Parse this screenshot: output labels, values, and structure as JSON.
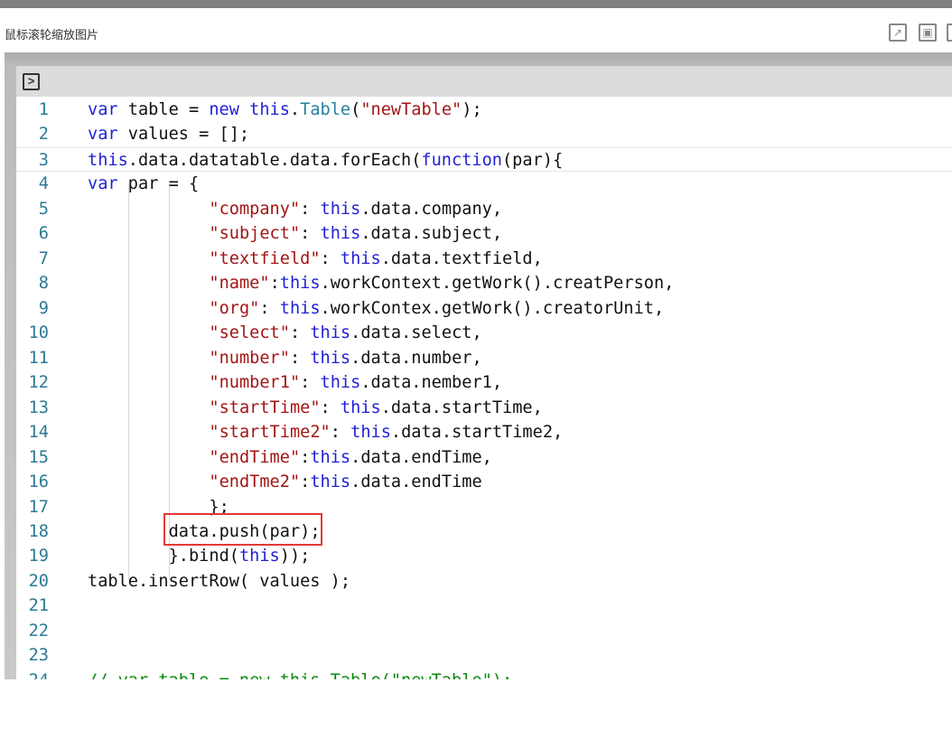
{
  "header": {
    "title": "鼠标滚轮缩放图片",
    "icons": [
      "open-external-icon",
      "fit-screen-icon",
      "more-icon"
    ]
  },
  "toolbar": {
    "run_icon": ">"
  },
  "colors": {
    "keyword": "#1f1fd8",
    "string": "#a31515",
    "highlight_box": "#e53935"
  },
  "code": {
    "highlighted_line": 18,
    "lines": [
      {
        "n": "1",
        "indent": 0,
        "t": [
          [
            "var",
            "kw"
          ],
          " table = ",
          [
            "new",
            "kw"
          ],
          " ",
          [
            "this",
            "kw"
          ],
          ".",
          [
            "Table",
            "cls"
          ],
          "(",
          [
            "\"newTable\"",
            "str"
          ],
          ");"
        ]
      },
      {
        "n": "2",
        "indent": 0,
        "t": [
          [
            "var",
            "kw"
          ],
          " values = [];"
        ]
      },
      {
        "n": "3",
        "indent": 0,
        "t": [
          [
            "this",
            "kw"
          ],
          ".data.datatable.data.forEach(",
          [
            "function",
            "kw"
          ],
          "(par){"
        ]
      },
      {
        "n": "4",
        "indent": 0,
        "t": [
          [
            "var",
            "kw"
          ],
          " par = {"
        ]
      },
      {
        "n": "5",
        "indent": 12,
        "t": [
          [
            "\"company\"",
            "str"
          ],
          ": ",
          [
            "this",
            "kw"
          ],
          ".data.company,"
        ]
      },
      {
        "n": "6",
        "indent": 12,
        "t": [
          [
            "\"subject\"",
            "str"
          ],
          ": ",
          [
            "this",
            "kw"
          ],
          ".data.subject,"
        ]
      },
      {
        "n": "7",
        "indent": 12,
        "t": [
          [
            "\"textfield\"",
            "str"
          ],
          ": ",
          [
            "this",
            "kw"
          ],
          ".data.textfield,"
        ]
      },
      {
        "n": "8",
        "indent": 12,
        "t": [
          [
            "\"name\"",
            "str"
          ],
          ":",
          [
            "this",
            "kw"
          ],
          ".workContext.getWork().creatPerson,"
        ]
      },
      {
        "n": "9",
        "indent": 12,
        "t": [
          [
            "\"org\"",
            "str"
          ],
          ": ",
          [
            "this",
            "kw"
          ],
          ".workContex.getWork().creatorUnit,"
        ]
      },
      {
        "n": "10",
        "indent": 12,
        "t": [
          [
            "\"select\"",
            "str"
          ],
          ": ",
          [
            "this",
            "kw"
          ],
          ".data.select,"
        ]
      },
      {
        "n": "11",
        "indent": 12,
        "t": [
          [
            "\"number\"",
            "str"
          ],
          ": ",
          [
            "this",
            "kw"
          ],
          ".data.number,"
        ]
      },
      {
        "n": "12",
        "indent": 12,
        "t": [
          [
            "\"number1\"",
            "str"
          ],
          ": ",
          [
            "this",
            "kw"
          ],
          ".data.nember1,"
        ]
      },
      {
        "n": "13",
        "indent": 12,
        "t": [
          [
            "\"startTime\"",
            "str"
          ],
          ": ",
          [
            "this",
            "kw"
          ],
          ".data.startTime,"
        ]
      },
      {
        "n": "14",
        "indent": 12,
        "t": [
          [
            "\"startTime2\"",
            "str"
          ],
          ": ",
          [
            "this",
            "kw"
          ],
          ".data.startTime2,"
        ]
      },
      {
        "n": "15",
        "indent": 12,
        "t": [
          [
            "\"endTime\"",
            "str"
          ],
          ":",
          [
            "this",
            "kw"
          ],
          ".data.endTime,"
        ]
      },
      {
        "n": "16",
        "indent": 12,
        "t": [
          [
            "\"endTme2\"",
            "str"
          ],
          ":",
          [
            "this",
            "kw"
          ],
          ".data.endTime"
        ]
      },
      {
        "n": "17",
        "indent": 12,
        "t": [
          "};"
        ]
      },
      {
        "n": "18",
        "indent": 8,
        "t": [
          "data.push(par);"
        ]
      },
      {
        "n": "19",
        "indent": 8,
        "t": [
          "}.bind(",
          [
            "this",
            "kw"
          ],
          "));"
        ]
      },
      {
        "n": "20",
        "indent": 0,
        "t": [
          "table.insertRow( values );"
        ]
      },
      {
        "n": "21",
        "indent": 0,
        "t": []
      },
      {
        "n": "22",
        "indent": 0,
        "t": []
      },
      {
        "n": "23",
        "indent": 0,
        "t": []
      },
      {
        "n": "24",
        "indent": 0,
        "t": [
          [
            "// var table = new this.Table(\"newTable\");",
            "cm"
          ]
        ]
      }
    ]
  }
}
